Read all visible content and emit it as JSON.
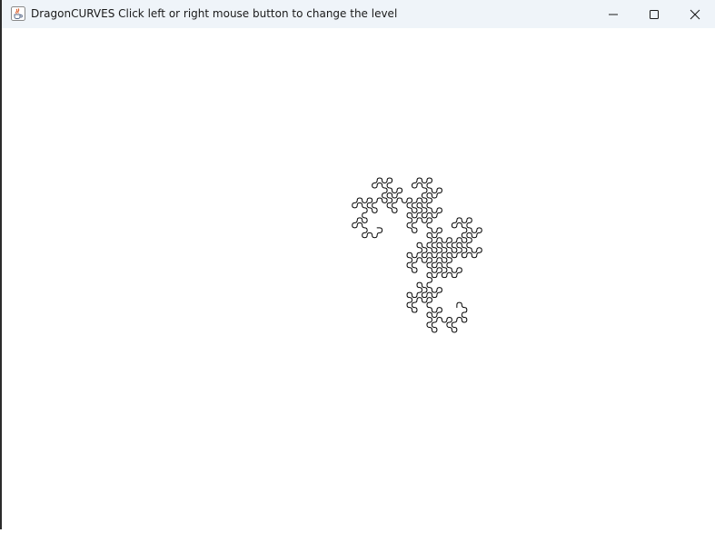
{
  "window": {
    "title": "DragonCURVES Click left or right mouse button to change the level",
    "app_icon": "java-coffee-cup-icon",
    "controls": {
      "minimize_icon": "minimize-icon",
      "maximize_icon": "maximize-icon",
      "close_icon": "close-icon"
    }
  },
  "canvas": {
    "background": "#ffffff",
    "stroke_color": "#000000",
    "figure": "dragon-curve"
  }
}
